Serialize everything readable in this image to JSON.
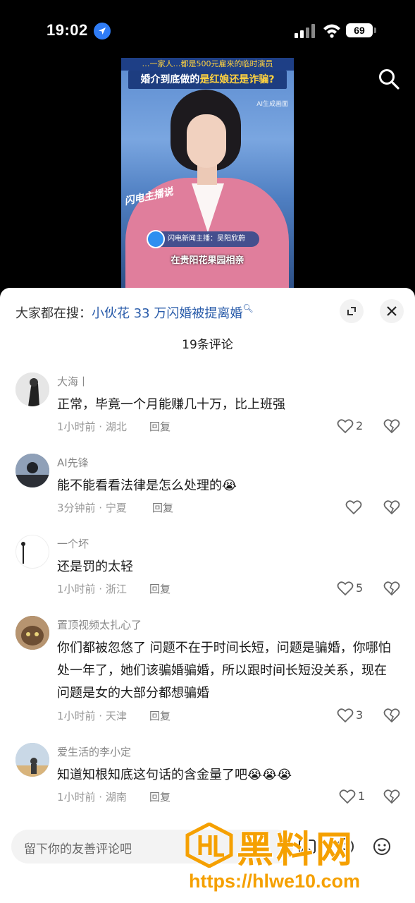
{
  "status_bar": {
    "time": "19:02",
    "battery": "69"
  },
  "video": {
    "top_banner": "…一家人…都是500元雇来的临时演员",
    "headline_prefix": "婚介到底做的",
    "headline_highlight": "是红娘还是诈骗?",
    "ai_label": "AI生成画面",
    "brand": "闪电主播说",
    "anchor_tag": "闪电新闻主播：吴阳欣蔚",
    "caption": "在贵阳花果园相亲"
  },
  "sheet": {
    "hot_search_prefix": "大家都在搜：",
    "hot_search_link": "小伙花 33 万闪婚被提离婚",
    "comment_count": "19条评论",
    "reply_label": "回复"
  },
  "comments": [
    {
      "user": "大海丨",
      "text": "正常，毕竟一个月能赚几十万，比上班强",
      "meta": "1小时前 · 湖北",
      "likes": "2"
    },
    {
      "user": "AI先锋",
      "text": "能不能看看法律是怎么处理的😭",
      "meta": "3分钟前 · 宁夏",
      "likes": ""
    },
    {
      "user": "一个坏",
      "text": "还是罚的太轻",
      "meta": "1小时前 · 浙江",
      "likes": "5"
    },
    {
      "user": "置顶视频太扎心了",
      "text": "你们都被忽悠了 问题不在于时间长短，问题是骗婚，你哪怕处一年了，她们该骗婚骗婚，所以跟时间长短没关系，现在问题是女的大部分都想骗婚",
      "meta": "1小时前 · 天津",
      "likes": "3"
    },
    {
      "user": "爱生活的李小定",
      "text": "知道知根知底这句话的含金量了吧😭😭😭",
      "meta": "1小时前 · 湖南",
      "likes": "1"
    }
  ],
  "input": {
    "placeholder": "留下你的友善评论吧"
  },
  "watermark": {
    "text": "黑料网",
    "url": "https://hlwe10.com"
  }
}
